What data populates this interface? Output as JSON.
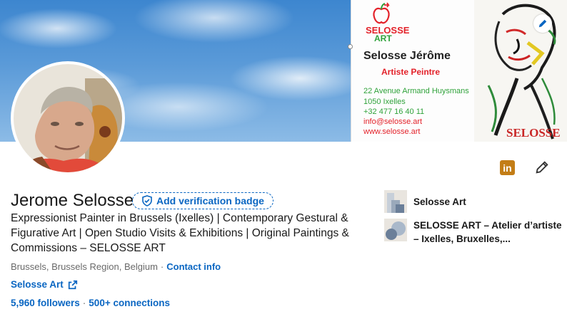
{
  "banner": {
    "brand_line1": "SELOSSE",
    "brand_line2": "ART",
    "card_name": "Selosse Jérôme",
    "card_role": "Artiste Peintre",
    "address_line1": "22 Avenue Armand Huysmans",
    "address_line2": "1050 Ixelles",
    "phone": "+32 477 16 40 11",
    "email": "info@selosse.art",
    "website": "www.selosse.art",
    "painting_signature": "SELOSSE"
  },
  "profile": {
    "name": "Jerome Selosse",
    "verification_label": "Add verification badge",
    "headline": "Expressionist Painter in Brussels (Ixelles) | Contemporary Gestural & Figurative Art | Open Studio Visits & Exhibitions | Original Paintings & Commissions – SELOSSE ART",
    "location": "Brussels, Brussels Region, Belgium",
    "contact_info": "Contact info",
    "website_label": "Selosse Art",
    "followers": "5,960 followers",
    "connections": "500+ connections"
  },
  "experience": [
    {
      "name": "Selosse Art"
    },
    {
      "name": "SELOSSE ART – Atelier d’artiste – Ixelles, Bruxelles,..."
    }
  ],
  "icons": {
    "linkedin_badge": "in",
    "edit_banner": "pencil-icon",
    "edit_profile": "pencil-icon"
  },
  "colors": {
    "link": "#0a66c2",
    "brand_red": "#e3222a",
    "brand_green": "#2fa23a",
    "linkedin_badge": "#c37d16"
  }
}
